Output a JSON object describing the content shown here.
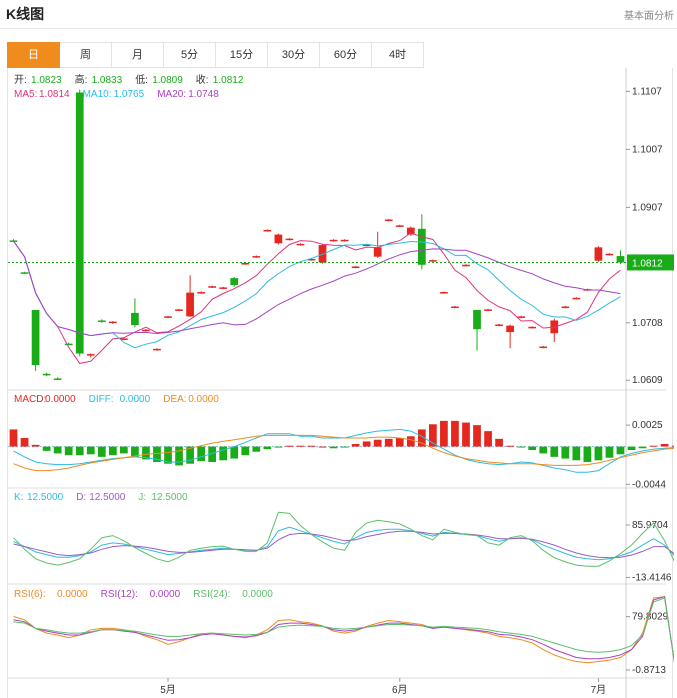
{
  "header": {
    "title": "K线图",
    "link": "基本面分析"
  },
  "tabs": [
    {
      "label": "日",
      "active": true
    },
    {
      "label": "周",
      "active": false
    },
    {
      "label": "月",
      "active": false
    },
    {
      "label": "5分",
      "active": false
    },
    {
      "label": "15分",
      "active": false
    },
    {
      "label": "30分",
      "active": false
    },
    {
      "label": "60分",
      "active": false
    },
    {
      "label": "4时",
      "active": false
    }
  ],
  "legend": {
    "ohlc": [
      {
        "label": "开:",
        "value": "1.0823"
      },
      {
        "label": "高:",
        "value": "1.0833"
      },
      {
        "label": "低:",
        "value": "1.0809"
      },
      {
        "label": "收:",
        "value": "1.0812"
      }
    ],
    "ma": [
      {
        "label": "MA5:",
        "value": "1.0814"
      },
      {
        "label": "MA10:",
        "value": "1.0765"
      },
      {
        "label": "MA20:",
        "value": "1.0748"
      }
    ],
    "macd": [
      {
        "label": "MACD:",
        "value": "0.0000"
      },
      {
        "label": "DIFF:",
        "value": "0.0000"
      },
      {
        "label": "DEA:",
        "value": "0.0000"
      }
    ],
    "kdj": [
      {
        "label": "K:",
        "value": "12.5000"
      },
      {
        "label": "D:",
        "value": "12.5000"
      },
      {
        "label": "J:",
        "value": "12.5000"
      }
    ],
    "rsi": [
      {
        "label": "RSI(6):",
        "value": "0.0000"
      },
      {
        "label": "RSI(12):",
        "value": "0.0000"
      },
      {
        "label": "RSI(24):",
        "value": "0.0000"
      }
    ]
  },
  "colors": {
    "up": "#e4271f",
    "down": "#1aac18",
    "ma5": "#e0337c",
    "ma10": "#2bbde0",
    "ma20": "#a743c2",
    "diff": "#2bbde0",
    "dea": "#ee8b21",
    "k": "#2bbde0",
    "d": "#9b5cc4",
    "j": "#5cbf6a",
    "rsi6": "#ee8b21",
    "rsi12": "#a743c2",
    "rsi24": "#5cbf6a"
  },
  "current_price_label": "1.0812",
  "chart_data": {
    "type": "candlestick",
    "x_tick_labels": [
      "5月",
      "6月",
      "7月"
    ],
    "price_axis": {
      "ticks": [
        "1.1107",
        "1.1007",
        "1.0907",
        "1.0708",
        "1.0609"
      ],
      "range": [
        1.0599,
        1.113
      ]
    },
    "macd_axis": {
      "ticks": [
        "0.0025",
        "-0.0044"
      ],
      "range": [
        -0.0046,
        0.0045
      ]
    },
    "kdj_axis": {
      "ticks": [
        "85.9704",
        "-13.4146"
      ],
      "range": [
        -22,
        122
      ]
    },
    "rsi_axis": {
      "ticks": [
        "79.8029",
        "-0.8713"
      ],
      "range": [
        -10,
        102
      ]
    },
    "candles": [
      {
        "o": 1.085,
        "h": 1.0852,
        "l": 1.0847,
        "c": 1.0849
      },
      {
        "o": 1.0795,
        "h": 1.0796,
        "l": 1.0793,
        "c": 1.0794
      },
      {
        "o": 1.073,
        "h": 1.073,
        "l": 1.0625,
        "c": 1.0635
      },
      {
        "o": 1.062,
        "h": 1.0622,
        "l": 1.0616,
        "c": 1.0618
      },
      {
        "o": 1.0612,
        "h": 1.0614,
        "l": 1.061,
        "c": 1.0611
      },
      {
        "o": 1.0672,
        "h": 1.0674,
        "l": 1.067,
        "c": 1.0671
      },
      {
        "o": 1.1105,
        "h": 1.111,
        "l": 1.065,
        "c": 1.0655
      },
      {
        "o": 1.0652,
        "h": 1.0655,
        "l": 1.0648,
        "c": 1.0654
      },
      {
        "o": 1.0712,
        "h": 1.0714,
        "l": 1.0708,
        "c": 1.0711
      },
      {
        "o": 1.0708,
        "h": 1.0711,
        "l": 1.0706,
        "c": 1.071
      },
      {
        "o": 1.068,
        "h": 1.0682,
        "l": 1.0678,
        "c": 1.0681
      },
      {
        "o": 1.0725,
        "h": 1.075,
        "l": 1.07,
        "c": 1.0704
      },
      {
        "o": 1.0695,
        "h": 1.0697,
        "l": 1.0693,
        "c": 1.0696
      },
      {
        "o": 1.0662,
        "h": 1.0664,
        "l": 1.066,
        "c": 1.0663
      },
      {
        "o": 1.0718,
        "h": 1.072,
        "l": 1.0716,
        "c": 1.0719
      },
      {
        "o": 1.073,
        "h": 1.0732,
        "l": 1.0728,
        "c": 1.0731
      },
      {
        "o": 1.0719,
        "h": 1.079,
        "l": 1.0718,
        "c": 1.076
      },
      {
        "o": 1.076,
        "h": 1.0762,
        "l": 1.0758,
        "c": 1.0761
      },
      {
        "o": 1.077,
        "h": 1.0772,
        "l": 1.0768,
        "c": 1.0771
      },
      {
        "o": 1.0768,
        "h": 1.077,
        "l": 1.0766,
        "c": 1.0769
      },
      {
        "o": 1.0785,
        "h": 1.0787,
        "l": 1.077,
        "c": 1.0773
      },
      {
        "o": 1.081,
        "h": 1.0812,
        "l": 1.0808,
        "c": 1.0811
      },
      {
        "o": 1.0822,
        "h": 1.0824,
        "l": 1.082,
        "c": 1.0823
      },
      {
        "o": 1.0867,
        "h": 1.0869,
        "l": 1.0865,
        "c": 1.0868
      },
      {
        "o": 1.0845,
        "h": 1.0862,
        "l": 1.0843,
        "c": 1.086
      },
      {
        "o": 1.0852,
        "h": 1.0854,
        "l": 1.085,
        "c": 1.0853
      },
      {
        "o": 1.0843,
        "h": 1.0845,
        "l": 1.0841,
        "c": 1.0844
      },
      {
        "o": 1.0817,
        "h": 1.0819,
        "l": 1.0815,
        "c": 1.0818
      },
      {
        "o": 1.0812,
        "h": 1.0843,
        "l": 1.081,
        "c": 1.0842
      },
      {
        "o": 1.085,
        "h": 1.0852,
        "l": 1.0848,
        "c": 1.0851
      },
      {
        "o": 1.085,
        "h": 1.0852,
        "l": 1.0848,
        "c": 1.0851
      },
      {
        "o": 1.0804,
        "h": 1.0806,
        "l": 1.0802,
        "c": 1.0805
      },
      {
        "o": 1.0842,
        "h": 1.0844,
        "l": 1.084,
        "c": 1.0843
      },
      {
        "o": 1.0822,
        "h": 1.0865,
        "l": 1.082,
        "c": 1.0838
      },
      {
        "o": 1.0885,
        "h": 1.0887,
        "l": 1.0883,
        "c": 1.0886
      },
      {
        "o": 1.0875,
        "h": 1.0877,
        "l": 1.0873,
        "c": 1.0876
      },
      {
        "o": 1.086,
        "h": 1.0874,
        "l": 1.0858,
        "c": 1.0872
      },
      {
        "o": 1.087,
        "h": 1.0895,
        "l": 1.08,
        "c": 1.0808
      },
      {
        "o": 1.0815,
        "h": 1.0817,
        "l": 1.0813,
        "c": 1.0816
      },
      {
        "o": 1.076,
        "h": 1.0762,
        "l": 1.0758,
        "c": 1.0761
      },
      {
        "o": 1.0735,
        "h": 1.0737,
        "l": 1.0733,
        "c": 1.0736
      },
      {
        "o": 1.0807,
        "h": 1.0809,
        "l": 1.0805,
        "c": 1.0808
      },
      {
        "o": 1.073,
        "h": 1.073,
        "l": 1.066,
        "c": 1.0697
      },
      {
        "o": 1.073,
        "h": 1.0732,
        "l": 1.0728,
        "c": 1.0731
      },
      {
        "o": 1.0704,
        "h": 1.0706,
        "l": 1.0702,
        "c": 1.0705
      },
      {
        "o": 1.0692,
        "h": 1.0705,
        "l": 1.0664,
        "c": 1.0703
      },
      {
        "o": 1.0718,
        "h": 1.072,
        "l": 1.0716,
        "c": 1.0719
      },
      {
        "o": 1.07,
        "h": 1.0702,
        "l": 1.0698,
        "c": 1.0701
      },
      {
        "o": 1.0666,
        "h": 1.0668,
        "l": 1.0664,
        "c": 1.0667
      },
      {
        "o": 1.069,
        "h": 1.0715,
        "l": 1.0675,
        "c": 1.0712
      },
      {
        "o": 1.0735,
        "h": 1.0737,
        "l": 1.0733,
        "c": 1.0736
      },
      {
        "o": 1.075,
        "h": 1.0752,
        "l": 1.0748,
        "c": 1.0751
      },
      {
        "o": 1.0765,
        "h": 1.0767,
        "l": 1.0763,
        "c": 1.0766
      },
      {
        "o": 1.0815,
        "h": 1.084,
        "l": 1.0813,
        "c": 1.0838
      },
      {
        "o": 1.0826,
        "h": 1.0828,
        "l": 1.0824,
        "c": 1.0827
      },
      {
        "o": 1.0823,
        "h": 1.0833,
        "l": 1.0809,
        "c": 1.0812
      }
    ],
    "macd_hist": [
      0.002,
      0.001,
      0.0002,
      -0.0005,
      -0.0008,
      -0.001,
      -0.001,
      -0.0009,
      -0.0012,
      -0.001,
      -0.0008,
      -0.0012,
      -0.0015,
      -0.0018,
      -0.002,
      -0.0022,
      -0.002,
      -0.0017,
      -0.0018,
      -0.0016,
      -0.0014,
      -0.001,
      -0.0006,
      -0.0003,
      -0.0001,
      0.0001,
      0.0001,
      0.0001,
      0.0,
      -0.0002,
      -0.0001,
      0.0003,
      0.0006,
      0.0008,
      0.0009,
      0.001,
      0.0012,
      0.002,
      0.0026,
      0.003,
      0.003,
      0.0028,
      0.0025,
      0.0018,
      0.0009,
      0.0001,
      -0.0001,
      -0.0004,
      -0.0008,
      -0.0012,
      -0.0014,
      -0.0016,
      -0.0018,
      -0.0016,
      -0.0013,
      -0.0009,
      -0.0004,
      -0.0002,
      0.0001,
      0.0003,
      0.0001
    ],
    "diff": [
      -0.0005,
      -0.0012,
      -0.0018,
      -0.002,
      -0.0021,
      -0.0021,
      -0.002,
      -0.0018,
      -0.0016,
      -0.0014,
      -0.0013,
      -0.0012,
      -0.0013,
      -0.0015,
      -0.0018,
      -0.0018,
      -0.0016,
      -0.0012,
      -0.0008,
      -0.0004,
      0.0,
      0.0005,
      0.001,
      0.0015,
      0.0015,
      0.0015,
      0.0012,
      0.0012,
      0.001,
      0.001,
      0.001,
      0.0013,
      0.0016,
      0.0018,
      0.0019,
      0.002,
      0.0018,
      0.0012,
      0.0004,
      -0.0003,
      -0.001,
      -0.0015,
      -0.0018,
      -0.002,
      -0.0021,
      -0.002,
      -0.0018,
      -0.0019,
      -0.0022,
      -0.0025,
      -0.0027,
      -0.003,
      -0.003,
      -0.0028,
      -0.002,
      -0.0012,
      -0.0008,
      -0.0005,
      -0.0003,
      -0.0002,
      -0.0001
    ],
    "dea": [
      -0.002,
      -0.0025,
      -0.0028,
      -0.0028,
      -0.0027,
      -0.0025,
      -0.0022,
      -0.0019,
      -0.0017,
      -0.0015,
      -0.0013,
      -0.0011,
      -0.0009,
      -0.0008,
      -0.0007,
      -0.0005,
      -0.0002,
      0.0001,
      0.0004,
      0.0006,
      0.0008,
      0.001,
      0.0012,
      0.0013,
      0.0013,
      0.0013,
      0.0013,
      0.0013,
      0.0012,
      0.0011,
      0.001,
      0.001,
      0.001,
      0.0011,
      0.0011,
      0.001,
      0.0008,
      0.0004,
      -0.0002,
      -0.0007,
      -0.0011,
      -0.0014,
      -0.0016,
      -0.0018,
      -0.0019,
      -0.002,
      -0.002,
      -0.002,
      -0.0021,
      -0.0022,
      -0.0022,
      -0.0022,
      -0.0021,
      -0.0019,
      -0.0016,
      -0.0013,
      -0.001,
      -0.0007,
      -0.0005,
      -0.0003,
      -0.0002
    ],
    "kdj_k": [
      55,
      45,
      35,
      30,
      25,
      25,
      28,
      35,
      48,
      52,
      50,
      45,
      40,
      35,
      30,
      32,
      35,
      38,
      40,
      42,
      40,
      38,
      38,
      45,
      75,
      82,
      75,
      68,
      62,
      55,
      50,
      62,
      72,
      76,
      78,
      78,
      75,
      70,
      65,
      72,
      70,
      68,
      66,
      60,
      55,
      60,
      62,
      58,
      48,
      40,
      32,
      25,
      22,
      20,
      22,
      28,
      35,
      48,
      60,
      48,
      25
    ],
    "kdj_d": [
      50,
      45,
      40,
      35,
      30,
      28,
      30,
      33,
      40,
      45,
      47,
      46,
      44,
      40,
      36,
      34,
      34,
      36,
      38,
      40,
      40,
      39,
      38,
      42,
      58,
      68,
      70,
      69,
      66,
      61,
      56,
      58,
      64,
      68,
      72,
      74,
      74,
      72,
      69,
      70,
      70,
      69,
      67,
      64,
      60,
      60,
      61,
      59,
      54,
      48,
      40,
      33,
      28,
      25,
      24,
      25,
      29,
      36,
      45,
      45,
      30
    ],
    "kdj_j": [
      62,
      40,
      22,
      14,
      10,
      15,
      22,
      40,
      62,
      66,
      56,
      43,
      32,
      22,
      16,
      25,
      38,
      42,
      45,
      46,
      40,
      36,
      36,
      52,
      110,
      108,
      85,
      68,
      54,
      42,
      38,
      72,
      90,
      95,
      92,
      88,
      78,
      66,
      58,
      78,
      72,
      68,
      66,
      52,
      48,
      62,
      66,
      56,
      38,
      24,
      16,
      10,
      8,
      8,
      18,
      32,
      48,
      70,
      90,
      56,
      12
    ],
    "rsi6": [
      80,
      75,
      62,
      55,
      52,
      48,
      52,
      60,
      62,
      62,
      60,
      57,
      50,
      45,
      38,
      42,
      48,
      54,
      55,
      52,
      50,
      48,
      52,
      60,
      74,
      75,
      72,
      70,
      66,
      58,
      55,
      58,
      65,
      70,
      74,
      72,
      70,
      68,
      62,
      65,
      62,
      60,
      58,
      55,
      50,
      48,
      45,
      40,
      30,
      22,
      16,
      12,
      10,
      12,
      14,
      18,
      30,
      55,
      108,
      110,
      -2
    ],
    "rsi12": [
      75,
      72,
      62,
      58,
      55,
      52,
      52,
      56,
      60,
      60,
      58,
      56,
      52,
      48,
      44,
      45,
      48,
      52,
      54,
      52,
      50,
      49,
      51,
      56,
      68,
      70,
      70,
      68,
      65,
      60,
      58,
      60,
      64,
      67,
      70,
      70,
      68,
      66,
      62,
      64,
      62,
      61,
      59,
      57,
      53,
      52,
      49,
      45,
      38,
      30,
      24,
      18,
      16,
      16,
      18,
      22,
      30,
      50,
      105,
      110,
      -2
    ],
    "rsi24": [
      72,
      70,
      62,
      60,
      57,
      55,
      55,
      57,
      60,
      60,
      59,
      58,
      55,
      52,
      50,
      50,
      52,
      54,
      55,
      54,
      53,
      52,
      53,
      56,
      64,
      66,
      67,
      66,
      65,
      62,
      61,
      62,
      64,
      66,
      68,
      68,
      67,
      66,
      64,
      65,
      64,
      63,
      62,
      60,
      57,
      55,
      53,
      50,
      45,
      40,
      35,
      30,
      27,
      26,
      27,
      30,
      36,
      52,
      102,
      108,
      -2
    ]
  }
}
